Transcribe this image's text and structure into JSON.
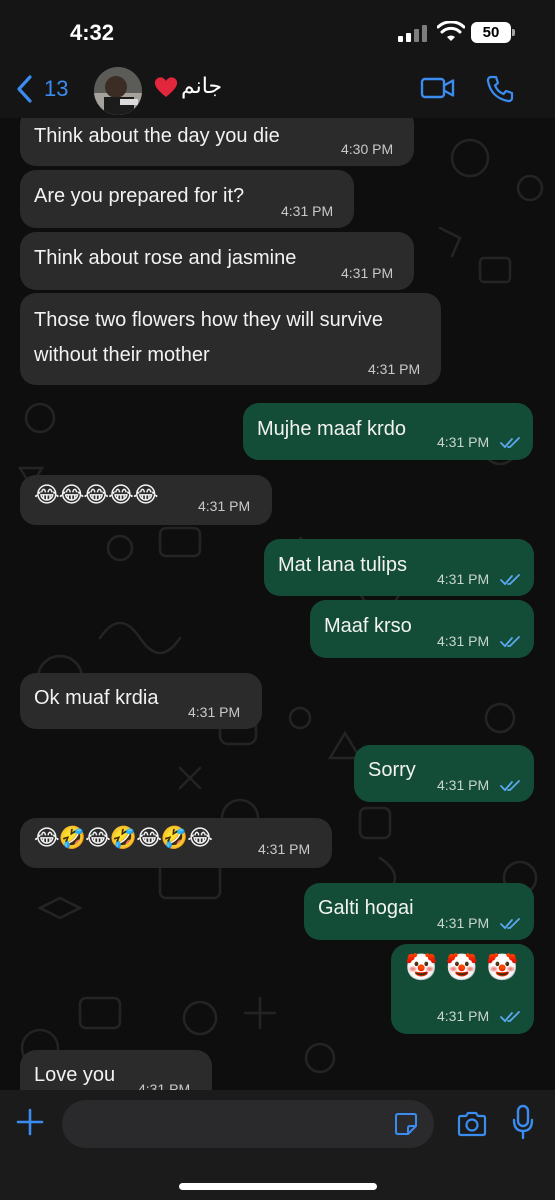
{
  "status_bar": {
    "time": "4:32",
    "battery": "50"
  },
  "header": {
    "unread_count": "13",
    "contact_name": "جانم"
  },
  "messages": [
    {
      "dir": "in",
      "text": "Think about the day you die",
      "time": "4:30 PM"
    },
    {
      "dir": "in",
      "text": "Are you prepared for it?",
      "time": "4:31 PM"
    },
    {
      "dir": "in",
      "text": "Think about rose and jasmine",
      "time": "4:31 PM"
    },
    {
      "dir": "in",
      "text": "Those two flowers how they will survive",
      "text2": "without their mother",
      "time": "4:31 PM"
    },
    {
      "dir": "out",
      "text": "Mujhe maaf krdo",
      "time": "4:31 PM",
      "status": "read"
    },
    {
      "dir": "in",
      "text": "😂😂😂😂😂",
      "time": "4:31 PM"
    },
    {
      "dir": "out",
      "text": "Mat lana tulips",
      "time": "4:31 PM",
      "status": "read"
    },
    {
      "dir": "out",
      "text": "Maaf krso",
      "time": "4:31 PM",
      "status": "read"
    },
    {
      "dir": "in",
      "text": "Ok muaf krdia",
      "time": "4:31 PM"
    },
    {
      "dir": "out",
      "text": "Sorry",
      "time": "4:31 PM",
      "status": "read"
    },
    {
      "dir": "in",
      "text": "😂🤣😂🤣😂🤣😂",
      "time": "4:31 PM"
    },
    {
      "dir": "out",
      "text": "Galti hogai",
      "time": "4:31 PM",
      "status": "read"
    },
    {
      "dir": "out",
      "text": "🤡 🤡 🤡",
      "time": "4:31 PM",
      "status": "read"
    },
    {
      "dir": "in",
      "text": "Love you",
      "time": "4:31 PM"
    }
  ],
  "composer": {
    "placeholder": ""
  },
  "colors": {
    "accent": "#3a8cf0",
    "outgoing_bubble": "#144d37",
    "incoming_bubble": "#2b2b2c",
    "read_ticks": "#5aa8f0"
  }
}
